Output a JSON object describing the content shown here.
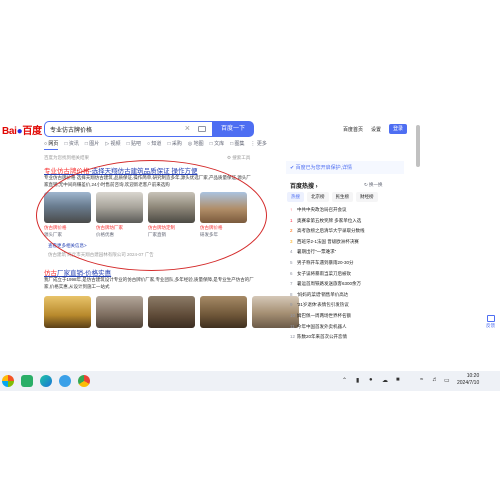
{
  "search": {
    "logo_text": "Bai",
    "logo_suffix": "百度",
    "query": "专业仿古牌价格",
    "button": "百度一下"
  },
  "top_links": [
    "百度首页",
    "设置",
    "登录"
  ],
  "tabs": [
    "网页",
    "资讯",
    "图片",
    "视频",
    "贴吧",
    "知道",
    "采购",
    "地图",
    "文库",
    "图集",
    "更多"
  ],
  "result_info": "百度为您找到相关结果",
  "search_tools": "搜索工具",
  "result1": {
    "title_red": "专业仿古牌价格",
    "title_rest": "-选择天翔仿古建筑品质保证 操作方便",
    "description": "专业仿古牌价格 选择天翔仿古建筑,品质保证,操作简单,研究制造多年,源头优选厂家,产品质量保证,源头厂家直销,无中间商赚差价,24小时售前咨询,欢迎新老客户前来选购",
    "thumbs": [
      {
        "caption": "仿古牌价格",
        "sub": "源头厂家"
      },
      {
        "caption": "仿古牌坊厂家",
        "sub": "价格优惠"
      },
      {
        "caption": "仿古牌坊定制",
        "sub": "厂家直销"
      },
      {
        "caption": "仿古牌价格",
        "sub": "研发多年"
      }
    ],
    "more_link": "查看更多相关信息>",
    "source": "仿古建筑 商丘市天翔古建园林有限公司 2024-07   广告"
  },
  "result2": {
    "title_red": "仿古",
    "title_rest": "厂家直销-价格实惠",
    "description": "我厂成立于1998年,是仿古建筑设计专业的仿古牌价厂家,专业团队,多年经验,质量保障,是专业生产仿古的厂家,价格实惠,从设计到施工一站式"
  },
  "notice": "百度已为您开启保护,详情",
  "hot": {
    "title": "百度热搜",
    "refresh": "换一换",
    "tabs": [
      "热搜",
      "北京榜",
      "民生榜",
      "财经榜"
    ],
    "items": [
      {
        "n": "↑",
        "text": "中共中央政治局召开会议"
      },
      {
        "n": "1",
        "text": "奥赛拿第五枚奖牌 多家单位入选"
      },
      {
        "n": "2",
        "text": "高考放榜之后清华大学录取分数线"
      },
      {
        "n": "3",
        "text": "西班牙2-1法国 晋级欧洲杯决赛"
      },
      {
        "n": "4",
        "text": "暑期出行\"一票难求\""
      },
      {
        "n": "5",
        "text": "男子称开车遇到暴雨20-30分"
      },
      {
        "n": "6",
        "text": "女子误将暴雨当菜刀后被砍"
      },
      {
        "n": "7",
        "text": "暑运首周铁路发送旅客6300余万"
      },
      {
        "n": "8",
        "text": "'妈妈的菜谱'销售单价高达"
      },
      {
        "n": "9",
        "text": "'31岁退休'表情包引发热议"
      },
      {
        "n": "10",
        "text": "姆巴佩一周两场世界杯名额"
      },
      {
        "n": "11",
        "text": "今年中国首发外卖机器人"
      },
      {
        "n": "12",
        "text": "陈数20年来首次公开恋情"
      }
    ]
  },
  "feedback": "反馈",
  "clock": {
    "time": "10:20",
    "date": "2024/7/10"
  },
  "colors": {
    "brand_blue": "#4e6ef2",
    "link_blue": "#2440b3",
    "highlight_red": "#f73131",
    "annotation_red": "#d42b2b"
  }
}
